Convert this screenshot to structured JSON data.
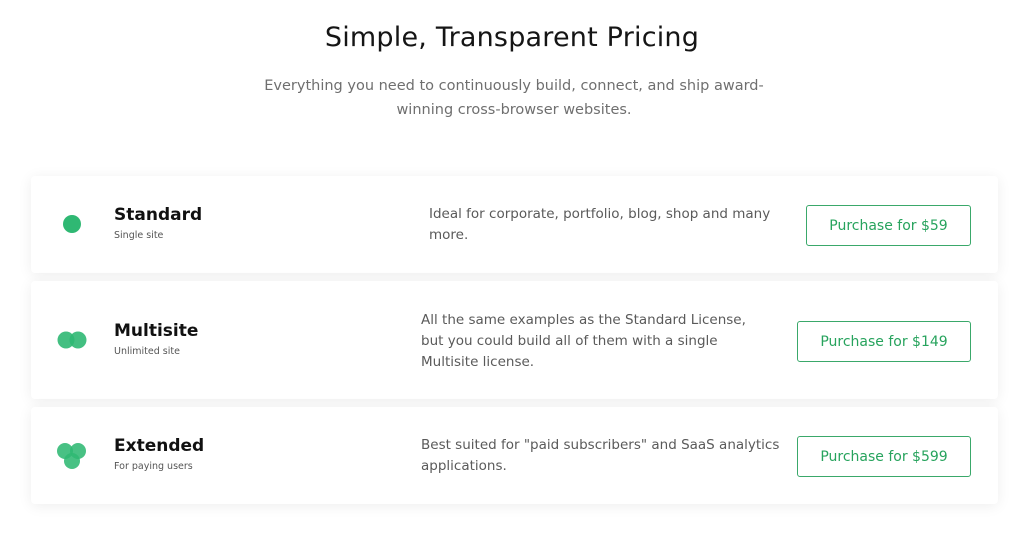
{
  "header": {
    "title": "Simple, Transparent Pricing",
    "subtitle": "Everything you need to continuously build, connect, and ship award-winning cross-browser websites."
  },
  "colors": {
    "accent": "#2fb873",
    "button_text": "#27a35d"
  },
  "plans": [
    {
      "name": "Standard",
      "tagline": "Single site",
      "description": "Ideal for corporate, portfolio, blog, shop and many more.",
      "button_label": "Purchase for $59",
      "icon": "single-dot-icon"
    },
    {
      "name": "Multisite",
      "tagline": "Unlimited site",
      "description": "All the same examples as the Standard License, but you could build all of them with a single Multisite license.",
      "button_label": "Purchase for $149",
      "icon": "double-dot-icon"
    },
    {
      "name": "Extended",
      "tagline": "For paying users",
      "description": "Best suited for \"paid subscribers\" and SaaS analytics applications.",
      "button_label": "Purchase for $599",
      "icon": "triple-dot-icon"
    }
  ]
}
